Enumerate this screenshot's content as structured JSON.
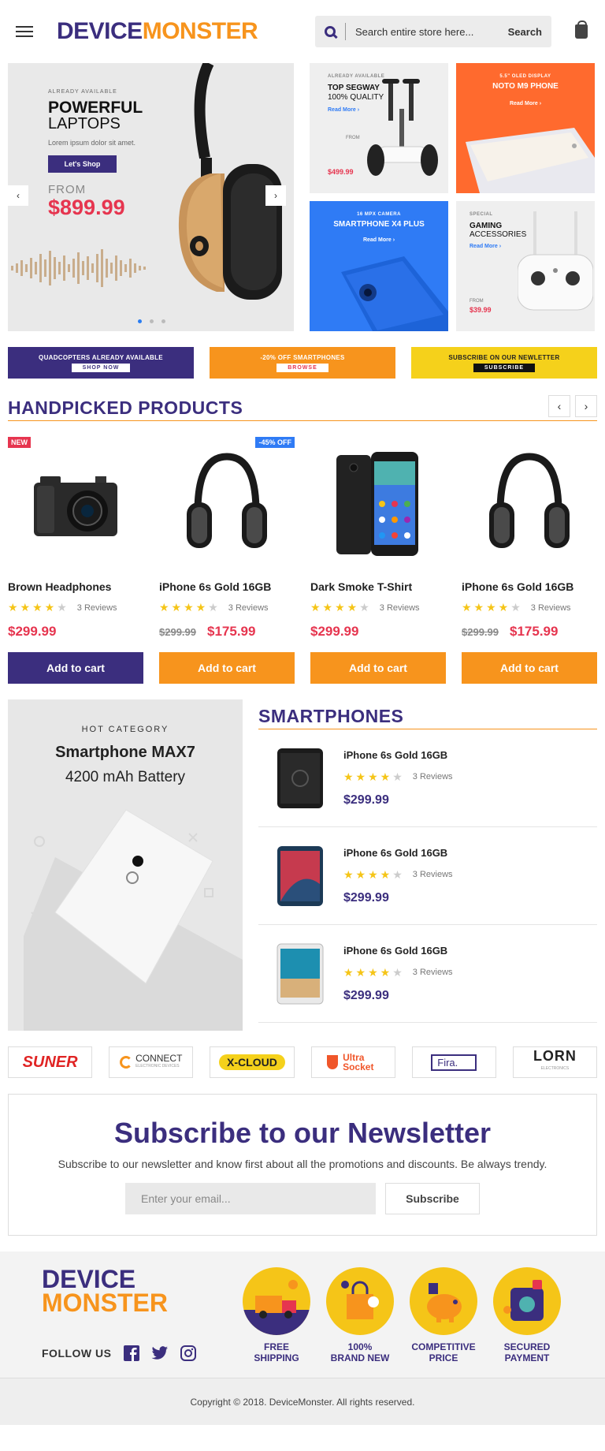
{
  "header": {
    "logo_part1": "DEVICE",
    "logo_part2": "MONSTER",
    "search_placeholder": "Search entire store here...",
    "search_button": "Search"
  },
  "hero": {
    "tag": "ALREADY AVAILABLE",
    "title_bold": "POWERFUL",
    "title_sub": "LAPTOPS",
    "lorem": "Lorem ipsum dolor sit amet.",
    "button": "Let's Shop",
    "from": "FROM",
    "price": "$899.99",
    "prev": "‹",
    "next": "›"
  },
  "tiles": [
    {
      "tag": "ALREADY AVAILABLE",
      "title": "TOP SEGWAY",
      "subtitle": "100% QUALITY",
      "link": "Read More ›",
      "from": "FROM",
      "price": "$499.99"
    },
    {
      "tag": "5.5\" OLED DISPLAY",
      "title": "NOTO M9 PHONE",
      "link": "Read More ›"
    },
    {
      "tag": "16 MPX CAMERA",
      "title": "SMARTPHONE X4 PLUS",
      "link": "Read More ›"
    },
    {
      "tag": "SPECIAL",
      "title": "GAMING",
      "subtitle": "ACCESSORIES",
      "link": "Read More ›",
      "from": "FROM",
      "price": "$39.99"
    }
  ],
  "promos": [
    {
      "text": "QUADCOPTERS ALREADY AVAILABLE",
      "button": "SHOP NOW"
    },
    {
      "text": "-20% OFF SMARTPHONES",
      "button": "BROWSE"
    },
    {
      "text": "SUBSCRIBE ON OUR NEWLETTER",
      "button": "SUBSCRIBE"
    }
  ],
  "handpicked": {
    "title": "HANDPICKED PRODUCTS",
    "prev": "‹",
    "next": "›",
    "products": [
      {
        "badge": "NEW",
        "name": "Brown Headphones",
        "reviews": "3 Reviews",
        "old_price": "",
        "price": "$299.99",
        "button": "Add to cart",
        "rating": 4
      },
      {
        "badge": "-45% OFF",
        "name": "iPhone 6s Gold 16GB",
        "reviews": "3 Reviews",
        "old_price": "$299.99",
        "price": "$175.99",
        "button": "Add to cart",
        "rating": 4
      },
      {
        "badge": "",
        "name": "Dark Smoke T-Shirt",
        "reviews": "3 Reviews",
        "old_price": "",
        "price": "$299.99",
        "button": "Add to cart",
        "rating": 4
      },
      {
        "badge": "",
        "name": "iPhone 6s Gold 16GB",
        "reviews": "3 Reviews",
        "old_price": "$299.99",
        "price": "$175.99",
        "button": "Add to cart",
        "rating": 4
      }
    ]
  },
  "hot": {
    "label": "HOT CATEGORY",
    "name": "Smartphone MAX7",
    "battery": "4200 mAh Battery"
  },
  "smartphones": {
    "title": "SMARTPHONES",
    "items": [
      {
        "name": "iPhone 6s Gold 16GB",
        "reviews": "3 Reviews",
        "price": "$299.99",
        "rating": 4
      },
      {
        "name": "iPhone 6s Gold 16GB",
        "reviews": "3 Reviews",
        "price": "$299.99",
        "rating": 4
      },
      {
        "name": "iPhone 6s Gold 16GB",
        "reviews": "3 Reviews",
        "price": "$299.99",
        "rating": 4
      }
    ]
  },
  "brands": [
    "SUNER",
    "CONNECT",
    "X-CLOUD",
    "Ultra Socket",
    "Fira.",
    "LORN"
  ],
  "brand_sub": {
    "connect": "ELECTRONIC DEVICES",
    "lorn": "ELECTRONICS"
  },
  "newsletter": {
    "title": "Subscribe to our Newsletter",
    "text": "Subscribe to our newsletter and know first about all the promotions and discounts. Be always trendy.",
    "placeholder": "Enter your email...",
    "button": "Subscribe"
  },
  "footer": {
    "logo_part1": "DEVICE",
    "logo_part2": "MONSTER",
    "follow": "FOLLOW US",
    "features": [
      {
        "line1": "FREE",
        "line2": "SHIPPING"
      },
      {
        "line1": "100%",
        "line2": "BRAND NEW"
      },
      {
        "line1": "COMPETITIVE",
        "line2": "PRICE"
      },
      {
        "line1": "SECURED",
        "line2": "PAYMENT"
      }
    ],
    "copyright": "Copyright © 2018. DeviceMonster. All rights reserved."
  },
  "colors": {
    "brand_purple": "#3b2e7e",
    "brand_orange": "#f7941d",
    "price_red": "#e6354f",
    "promo_yellow": "#f5c518",
    "tile_orange": "#ff6a2e",
    "tile_blue": "#2f7bf5"
  }
}
